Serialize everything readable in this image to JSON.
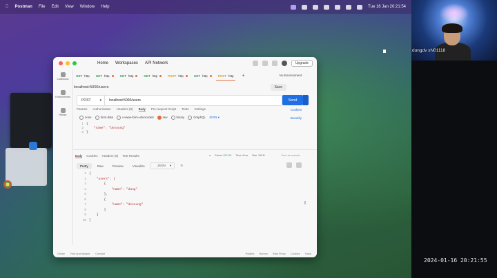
{
  "menubar": {
    "app": "Postman",
    "items": [
      "File",
      "Edit",
      "View",
      "Window",
      "Help"
    ],
    "clock": "Tue 16 Jan  20:21:54"
  },
  "window": {
    "nav": {
      "home": "Home",
      "workspaces": "Workspaces",
      "api_network": "API Network"
    },
    "upgrade": "Upgrade",
    "tabs": [
      {
        "method": "GET",
        "label": "http",
        "active": false
      },
      {
        "method": "GET",
        "label": "http",
        "active": false
      },
      {
        "method": "GET",
        "label": "http",
        "active": false
      },
      {
        "method": "GET",
        "label": "http",
        "active": false
      },
      {
        "method": "POST",
        "label": "http",
        "active": false
      },
      {
        "method": "GET",
        "label": "http",
        "active": false
      },
      {
        "method": "POST",
        "label": "http",
        "active": true
      }
    ],
    "environment": "No Environment",
    "sidebar": [
      "Collections",
      "Environments",
      "History"
    ],
    "request": {
      "name": "localhost:5000/users",
      "save": "Save",
      "method": "POST",
      "url": "localhost:5000/users",
      "send": "Send"
    },
    "subtabs": [
      "Params",
      "Authorization",
      "Headers (8)",
      "Body",
      "Pre-request Script",
      "Tests",
      "Settings"
    ],
    "active_subtab": "Body",
    "cookies": "Cookies",
    "beautify": "Beautify",
    "body_types": [
      "none",
      "form-data",
      "x-www-form-urlencoded",
      "raw",
      "binary",
      "GraphQL",
      "JSON"
    ],
    "active_body_type": "raw",
    "body_lines": [
      "{",
      "    \"name\": \"dvsoung\"",
      "}"
    ],
    "response": {
      "tabs": [
        "Body",
        "Cookies",
        "Headers (8)",
        "Test Results"
      ],
      "status": "Status: 200 OK",
      "time": "Time: 8 ms",
      "size": "Size: 315 B",
      "save_example": "Save as example",
      "views": [
        "Pretty",
        "Raw",
        "Preview",
        "Visualize",
        "JSON"
      ],
      "lines": [
        "{",
        "    \"users\": [",
        "        {",
        "            \"name\": \"dung\"",
        "        },",
        "        {",
        "            \"name\": \"dvsoung\"",
        "        }",
        "    ]",
        "}"
      ]
    },
    "statusbar": {
      "left": [
        "Online",
        "Find and replace",
        "Console"
      ],
      "right": [
        "Postbot",
        "Runner",
        "Start Proxy",
        "Cookies",
        "Trash"
      ]
    }
  },
  "webcam": {
    "name": "dungdv xN01118"
  },
  "timestamp": "2024-01-16  20:21:55",
  "colors": {
    "accent": "#1f6fe5",
    "get": "#2f9a55",
    "post": "#d59a1c",
    "active_tab": "#e06c3b"
  }
}
